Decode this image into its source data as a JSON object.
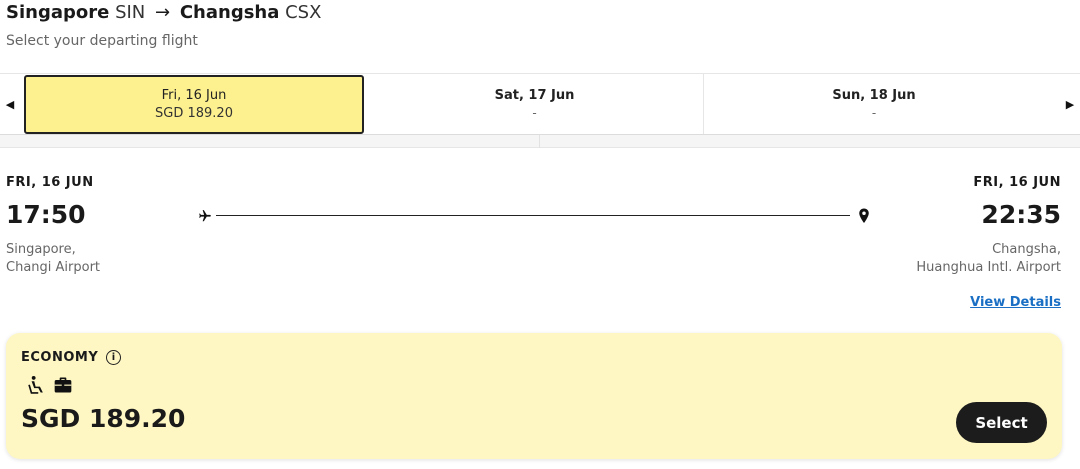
{
  "header": {
    "origin_city": "Singapore",
    "origin_code": "SIN",
    "arrow": "→",
    "dest_city": "Changsha",
    "dest_code": "CSX",
    "subtitle": "Select your departing flight"
  },
  "date_tabs": [
    {
      "date": "Fri, 16 Jun",
      "price": "SGD 189.20",
      "selected": true
    },
    {
      "date": "Sat, 17 Jun",
      "price": "-",
      "selected": false
    },
    {
      "date": "Sun, 18 Jun",
      "price": "-",
      "selected": false
    }
  ],
  "nav": {
    "prev_glyph": "◀",
    "next_glyph": "▶"
  },
  "flight": {
    "departure": {
      "date": "FRI, 16 JUN",
      "time": "17:50",
      "city": "Singapore,",
      "airport": "Changi Airport"
    },
    "arrival": {
      "date": "FRI, 16 JUN",
      "time": "22:35",
      "city": "Changsha,",
      "airport": "Huanghua Intl. Airport"
    },
    "view_details": "View Details"
  },
  "fare": {
    "class_name": "ECONOMY",
    "info_glyph": "i",
    "icons": [
      "seat-icon",
      "briefcase-icon"
    ],
    "price": "SGD 189.20",
    "select_label": "Select"
  },
  "colors": {
    "selected_tab_bg": "#fdf08f",
    "fare_card_bg": "#fef7c3",
    "link": "#1a6fc4",
    "button_bg": "#1c1c1c"
  }
}
